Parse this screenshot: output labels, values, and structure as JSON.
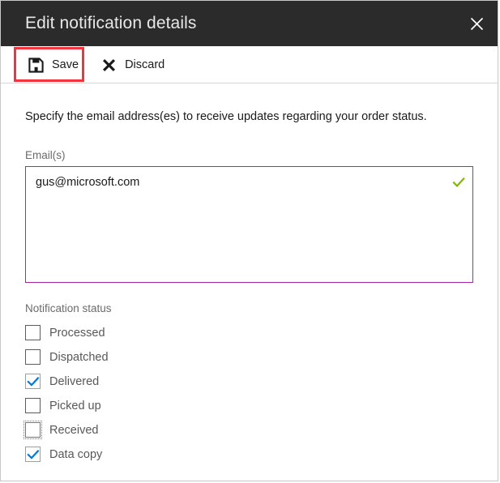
{
  "header": {
    "title": "Edit notification details",
    "close_icon": "close-icon"
  },
  "toolbar": {
    "save_label": "Save",
    "save_icon": "save-floppy-icon",
    "discard_label": "Discard",
    "discard_icon": "close-x-icon",
    "highlight_color": "#f5333f",
    "highlighted_button": "Save"
  },
  "body": {
    "instruction": "Specify the email address(es) to receive updates regarding your order status.",
    "email_field": {
      "label": "Email(s)",
      "value": "gus@microsoft.com",
      "placeholder": "",
      "border_color": "#a626a6",
      "validation_icon": "green-check-icon",
      "validation_color": "#7cbb00"
    },
    "notification_status": {
      "label": "Notification status",
      "items": [
        {
          "label": "Processed",
          "checked": false,
          "state": "unchecked"
        },
        {
          "label": "Dispatched",
          "checked": false,
          "state": "unchecked"
        },
        {
          "label": "Delivered",
          "checked": true,
          "state": "checked"
        },
        {
          "label": "Picked up",
          "checked": false,
          "state": "unchecked"
        },
        {
          "label": "Received",
          "checked": false,
          "state": "focused"
        },
        {
          "label": "Data copy",
          "checked": true,
          "state": "checked"
        }
      ],
      "unchecked_border_color": "#a626a6",
      "focused_border_color": "#0b9ae0",
      "checked_border_color": "#9e9e9e",
      "check_color": "#0078d7"
    }
  },
  "colors": {
    "header_bg": "#2b2b2b",
    "header_text": "#e8e8e8",
    "body_bg": "#ffffff",
    "divider": "#d6d6d6"
  }
}
